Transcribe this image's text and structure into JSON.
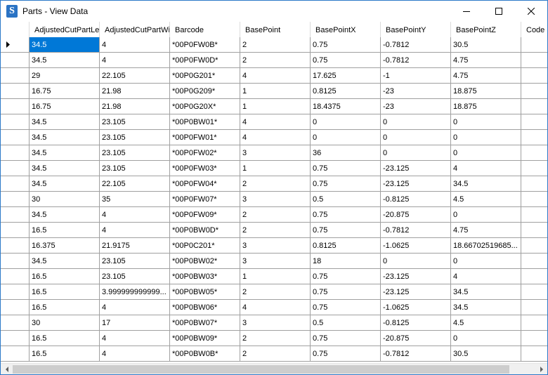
{
  "window": {
    "title": "Parts - View Data"
  },
  "colors": {
    "titlebar_border": "#2b79c9",
    "selection": "#0078d7",
    "grid_line": "#a0a0a0",
    "app_icon": "#2a73c4"
  },
  "icons": {
    "app": "s-logo-icon",
    "minimize": "minimize-icon",
    "maximize": "maximize-icon",
    "close": "close-icon",
    "row_pointer": "row-pointer-icon",
    "scroll_left": "scroll-left-icon",
    "scroll_right": "scroll-right-icon"
  },
  "columns": [
    "AdjustedCutPartLen",
    "AdjustedCutPartWid",
    "Barcode",
    "BasePoint",
    "BasePointX",
    "BasePointY",
    "BasePointZ",
    "Code"
  ],
  "rows": [
    [
      "34.5",
      "4",
      "*00P0FW0B*",
      "2",
      "0.75",
      "-0.7812",
      "30.5",
      ""
    ],
    [
      "34.5",
      "4",
      "*00P0FW0D*",
      "2",
      "0.75",
      "-0.7812",
      "4.75",
      ""
    ],
    [
      "29",
      "22.105",
      "*00P0G201*",
      "4",
      "17.625",
      "-1",
      "4.75",
      ""
    ],
    [
      "16.75",
      "21.98",
      "*00P0G209*",
      "1",
      "0.8125",
      "-23",
      "18.875",
      ""
    ],
    [
      "16.75",
      "21.98",
      "*00P0G20X*",
      "1",
      "18.4375",
      "-23",
      "18.875",
      ""
    ],
    [
      "34.5",
      "23.105",
      "*00P0BW01*",
      "4",
      "0",
      "0",
      "0",
      ""
    ],
    [
      "34.5",
      "23.105",
      "*00P0FW01*",
      "4",
      "0",
      "0",
      "0",
      ""
    ],
    [
      "34.5",
      "23.105",
      "*00P0FW02*",
      "3",
      "36",
      "0",
      "0",
      ""
    ],
    [
      "34.5",
      "23.105",
      "*00P0FW03*",
      "1",
      "0.75",
      "-23.125",
      "4",
      ""
    ],
    [
      "34.5",
      "22.105",
      "*00P0FW04*",
      "2",
      "0.75",
      "-23.125",
      "34.5",
      ""
    ],
    [
      "30",
      "35",
      "*00P0FW07*",
      "3",
      "0.5",
      "-0.8125",
      "4.5",
      ""
    ],
    [
      "34.5",
      "4",
      "*00P0FW09*",
      "2",
      "0.75",
      "-20.875",
      "0",
      ""
    ],
    [
      "16.5",
      "4",
      "*00P0BW0D*",
      "2",
      "0.75",
      "-0.7812",
      "4.75",
      ""
    ],
    [
      "16.375",
      "21.9175",
      "*00P0C201*",
      "3",
      "0.8125",
      "-1.0625",
      "18.66702519685...",
      ""
    ],
    [
      "34.5",
      "23.105",
      "*00P0BW02*",
      "3",
      "18",
      "0",
      "0",
      ""
    ],
    [
      "16.5",
      "23.105",
      "*00P0BW03*",
      "1",
      "0.75",
      "-23.125",
      "4",
      ""
    ],
    [
      "16.5",
      "3.999999999999...",
      "*00P0BW05*",
      "2",
      "0.75",
      "-23.125",
      "34.5",
      ""
    ],
    [
      "16.5",
      "4",
      "*00P0BW06*",
      "4",
      "0.75",
      "-1.0625",
      "34.5",
      ""
    ],
    [
      "30",
      "17",
      "*00P0BW07*",
      "3",
      "0.5",
      "-0.8125",
      "4.5",
      ""
    ],
    [
      "16.5",
      "4",
      "*00P0BW09*",
      "2",
      "0.75",
      "-20.875",
      "0",
      ""
    ],
    [
      "16.5",
      "4",
      "*00P0BW0B*",
      "2",
      "0.75",
      "-0.7812",
      "30.5",
      ""
    ]
  ]
}
